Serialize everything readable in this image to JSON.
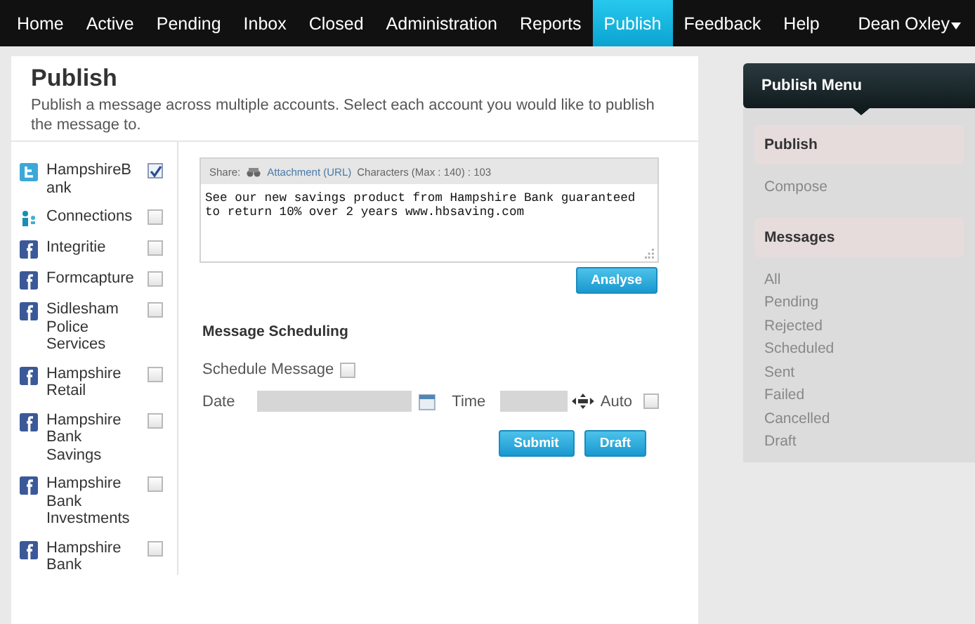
{
  "nav": {
    "items": [
      {
        "label": "Home",
        "selected": false
      },
      {
        "label": "Active",
        "selected": false
      },
      {
        "label": "Pending",
        "selected": false
      },
      {
        "label": "Inbox",
        "selected": false
      },
      {
        "label": "Closed",
        "selected": false
      },
      {
        "label": "Administration",
        "selected": false
      },
      {
        "label": "Reports",
        "selected": false
      },
      {
        "label": "Publish",
        "selected": true
      },
      {
        "label": "Feedback",
        "selected": false
      },
      {
        "label": "Help",
        "selected": false
      }
    ],
    "user": "Dean Oxley"
  },
  "page": {
    "title": "Publish",
    "description": "Publish a message across multiple accounts. Select each account you would like to publish the message to."
  },
  "accounts": [
    {
      "name": "HampshireBank",
      "kind": "twitter",
      "checked": true
    },
    {
      "name": "Connections",
      "kind": "connections",
      "checked": false
    },
    {
      "name": "Integritie",
      "kind": "facebook",
      "checked": false
    },
    {
      "name": "Formcapture",
      "kind": "facebook",
      "checked": false
    },
    {
      "name": "Sidlesham Police Services",
      "kind": "facebook",
      "checked": false
    },
    {
      "name": "Hampshire Retail",
      "kind": "facebook",
      "checked": false
    },
    {
      "name": "Hampshire Bank Savings",
      "kind": "facebook",
      "checked": false
    },
    {
      "name": "Hampshire Bank Investments",
      "kind": "facebook",
      "checked": false
    },
    {
      "name": "Hampshire Bank",
      "kind": "facebook",
      "checked": false
    }
  ],
  "composer": {
    "share_label": "Share:",
    "attachment_link": "Attachment (URL)",
    "char_count": "Characters (Max : 140) : 103",
    "message": "See our new savings product from Hampshire Bank guaranteed to return 10% over 2 years www.hbsaving.com",
    "analyse_button": "Analyse"
  },
  "scheduling": {
    "heading": "Message Scheduling",
    "schedule_label": "Schedule Message",
    "schedule_checked": false,
    "date_label": "Date",
    "time_label": "Time",
    "auto_label": "Auto",
    "auto_checked": false,
    "buttons": [
      "Submit",
      "Draft"
    ]
  },
  "menu": {
    "title": "Publish Menu",
    "sections": [
      {
        "heading": "Publish",
        "items": [
          "Compose"
        ]
      },
      {
        "heading": "Messages",
        "items": [
          "All",
          "Pending",
          "Rejected",
          "Scheduled",
          "Sent",
          "Failed",
          "Cancelled",
          "Draft"
        ]
      }
    ]
  }
}
